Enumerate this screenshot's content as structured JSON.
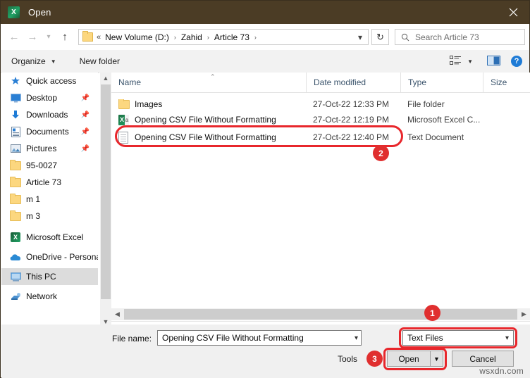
{
  "window": {
    "title": "Open",
    "app_icon": "excel-icon",
    "close_icon": "close-icon"
  },
  "nav": {
    "back_icon": "arrow-left-icon",
    "forward_icon": "arrow-right-icon",
    "recent_icon": "chevron-down-icon",
    "up_icon": "arrow-up-icon",
    "breadcrumb_overflow": "«",
    "breadcrumb": [
      "New Volume (D:)",
      "Zahid",
      "Article 73"
    ],
    "breadcrumb_separator": "›",
    "dropdown_icon": "chevron-down-icon",
    "refresh_icon": "refresh-icon"
  },
  "search": {
    "icon": "search-icon",
    "placeholder": "Search Article 73",
    "value": ""
  },
  "toolbar": {
    "organize_label": "Organize",
    "organize_caret": "▼",
    "new_folder_label": "New folder",
    "view_mode_icon": "list-view-icon",
    "view_caret": "▼",
    "preview_pane_icon": "preview-pane-icon",
    "help_label": "?"
  },
  "sidebar": {
    "items": [
      {
        "label": "Quick access",
        "icon": "star-pin-icon",
        "pinned": false,
        "selected": false
      },
      {
        "label": "Desktop",
        "icon": "desktop-icon",
        "pinned": true,
        "selected": false
      },
      {
        "label": "Downloads",
        "icon": "download-icon",
        "pinned": true,
        "selected": false
      },
      {
        "label": "Documents",
        "icon": "documents-icon",
        "pinned": true,
        "selected": false
      },
      {
        "label": "Pictures",
        "icon": "pictures-icon",
        "pinned": true,
        "selected": false
      },
      {
        "label": "95-0027",
        "icon": "folder-icon",
        "pinned": false,
        "selected": false
      },
      {
        "label": "Article 73",
        "icon": "folder-icon",
        "pinned": false,
        "selected": false
      },
      {
        "label": "m 1",
        "icon": "folder-icon",
        "pinned": false,
        "selected": false
      },
      {
        "label": "m 3",
        "icon": "folder-icon",
        "pinned": false,
        "selected": false
      },
      {
        "label": "Microsoft Excel",
        "icon": "excel-icon",
        "pinned": false,
        "selected": false
      },
      {
        "label": "OneDrive - Personal",
        "icon": "onedrive-icon",
        "pinned": false,
        "selected": false
      },
      {
        "label": "This PC",
        "icon": "this-pc-icon",
        "pinned": false,
        "selected": true
      },
      {
        "label": "Network",
        "icon": "network-icon",
        "pinned": false,
        "selected": false
      }
    ],
    "scroll_up_icon": "chevron-up-icon",
    "scroll_down_icon": "chevron-down-icon"
  },
  "file_list": {
    "columns": [
      "Name",
      "Date modified",
      "Type",
      "Size"
    ],
    "sort_indicator": "⌃",
    "rows": [
      {
        "name": "Images",
        "date_modified": "27-Oct-22 12:33 PM",
        "type": "File folder",
        "size": "",
        "icon": "folder-icon"
      },
      {
        "name": "Opening CSV File Without Formatting",
        "date_modified": "27-Oct-22 12:19 PM",
        "type": "Microsoft Excel C...",
        "size": "",
        "icon": "excel-csv-icon"
      },
      {
        "name": "Opening CSV File Without Formatting",
        "date_modified": "27-Oct-22 12:40 PM",
        "type": "Text Document",
        "size": "",
        "icon": "text-document-icon"
      }
    ],
    "hscroll_left_icon": "chevron-left-icon",
    "hscroll_right_icon": "chevron-right-icon"
  },
  "bottom": {
    "filename_label": "File name:",
    "filename_value": "Opening CSV File Without Formatting",
    "filename_placeholder": "File name",
    "filename_dropdown_icon": "chevron-down-icon",
    "filetype_value": "Text Files",
    "filetype_caret_icon": "chevron-down-icon",
    "tools_label": "Tools",
    "open_label": "Open",
    "open_split_icon": "▼",
    "cancel_label": "Cancel",
    "watermark": "wsxdn.com"
  },
  "annotations": {
    "badges": [
      "1",
      "2",
      "3"
    ],
    "highlight_color": "#e8272c"
  }
}
